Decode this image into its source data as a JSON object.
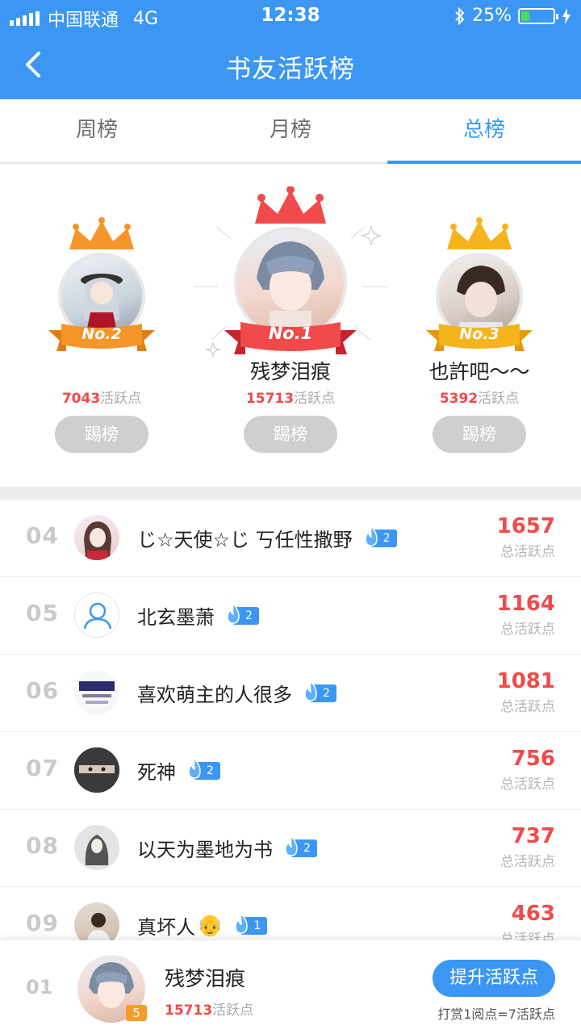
{
  "status_bar": {
    "carrier": "中国联通",
    "network": "4G",
    "time": "12:38",
    "battery_percent": "25%",
    "battery_level": 0.25
  },
  "nav": {
    "title": "书友活跃榜",
    "back_icon": "chevron-left-icon"
  },
  "tabs": [
    {
      "label": "周榜",
      "active": false
    },
    {
      "label": "月榜",
      "active": false
    },
    {
      "label": "总榜",
      "active": true
    }
  ],
  "podium": {
    "first": {
      "ribbon": "No.1",
      "name": "残梦泪痕",
      "score": "15713",
      "score_suffix": "活跃点",
      "kick_label": "踢榜",
      "crown_color": "#f04a4a"
    },
    "second": {
      "ribbon": "No.2",
      "name": "",
      "score": "7043",
      "score_suffix": "活跃点",
      "kick_label": "踢榜",
      "crown_color": "#f5952a"
    },
    "third": {
      "ribbon": "No.3",
      "name": "也許吧～～",
      "score": "5392",
      "score_suffix": "活跃点",
      "kick_label": "踢榜",
      "crown_color": "#f5b41e"
    }
  },
  "list": {
    "score_label": "总活跃点",
    "rows": [
      {
        "rank": "04",
        "name": "じ☆天使☆じ 丂任性撒野",
        "level": "2",
        "score": "1657"
      },
      {
        "rank": "05",
        "name": "北玄墨萧",
        "level": "2",
        "score": "1164"
      },
      {
        "rank": "06",
        "name": "喜欢萌主的人很多",
        "level": "2",
        "score": "1081"
      },
      {
        "rank": "07",
        "name": "死神",
        "level": "2",
        "score": "756"
      },
      {
        "rank": "08",
        "name": "以天为墨地为书",
        "level": "2",
        "score": "737"
      },
      {
        "rank": "09",
        "name": "真坏人",
        "emoji": "👴",
        "level": "1",
        "score": "463"
      }
    ]
  },
  "me": {
    "rank": "01",
    "name": "残梦泪痕",
    "score": "15713",
    "score_suffix": "活跃点",
    "badge": "5",
    "boost_label": "提升活跃点",
    "note": "打赏1阅点=7活跃点"
  },
  "colors": {
    "brand_blue": "#3b97f3",
    "score_red": "#f04a4a",
    "rank_gray": "#c9c9c9"
  }
}
